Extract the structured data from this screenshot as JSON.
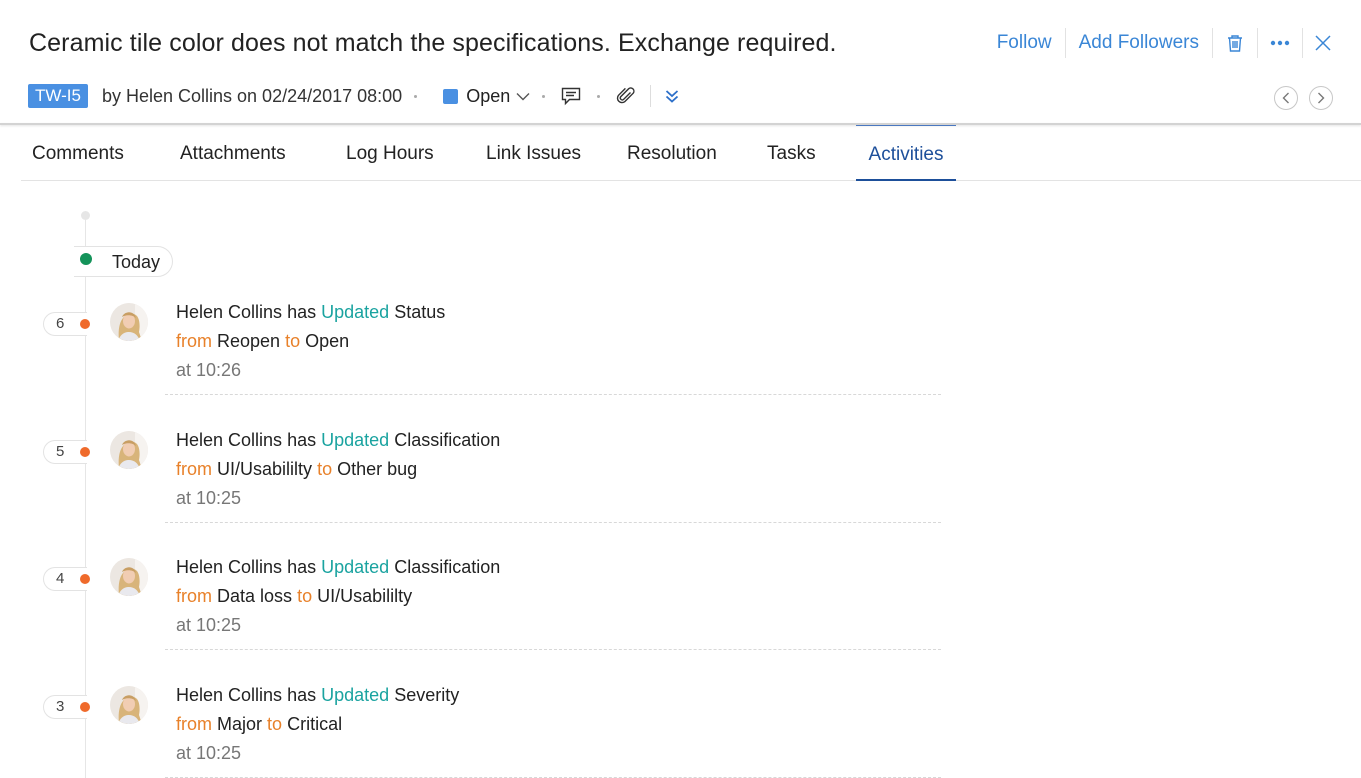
{
  "issue": {
    "title": "Ceramic tile color does not match the specifications. Exchange required.",
    "id": "TW-I5",
    "byline": "by Helen Collins on 02/24/2017 08:00",
    "status": "Open",
    "status_color": "#4a90e2"
  },
  "actions": {
    "follow": "Follow",
    "add_followers": "Add Followers"
  },
  "tabs": [
    {
      "label": "Comments"
    },
    {
      "label": "Attachments"
    },
    {
      "label": "Log Hours"
    },
    {
      "label": "Link Issues"
    },
    {
      "label": "Resolution"
    },
    {
      "label": "Tasks"
    },
    {
      "label": "Activities",
      "active": true
    }
  ],
  "timeline": {
    "group_label": "Today",
    "activities": [
      {
        "num": "6",
        "user": "Helen Collins",
        "has": "has",
        "verb": "Updated",
        "field": "Status",
        "from_word": "from",
        "from": "Reopen",
        "to_word": "to",
        "to": "Open",
        "time": "at 10:26"
      },
      {
        "num": "5",
        "user": "Helen Collins",
        "has": "has",
        "verb": "Updated",
        "field": "Classification",
        "from_word": "from",
        "from": "UI/Usabililty",
        "to_word": "to",
        "to": "Other bug",
        "time": "at 10:25"
      },
      {
        "num": "4",
        "user": "Helen Collins",
        "has": "has",
        "verb": "Updated",
        "field": "Classification",
        "from_word": "from",
        "from": "Data loss",
        "to_word": "to",
        "to": "UI/Usabililty",
        "time": "at 10:25"
      },
      {
        "num": "3",
        "user": "Helen Collins",
        "has": "has",
        "verb": "Updated",
        "field": "Severity",
        "from_word": "from",
        "from": "Major",
        "to_word": "to",
        "to": "Critical",
        "time": "at 10:25"
      }
    ]
  },
  "colors": {
    "link_blue": "#3a86d6",
    "active_tab": "#1d4f9a",
    "today_dot": "#14935a",
    "activity_dot": "#ef6a2b",
    "verb": "#1aa3a0",
    "from_to": "#e8812a"
  }
}
